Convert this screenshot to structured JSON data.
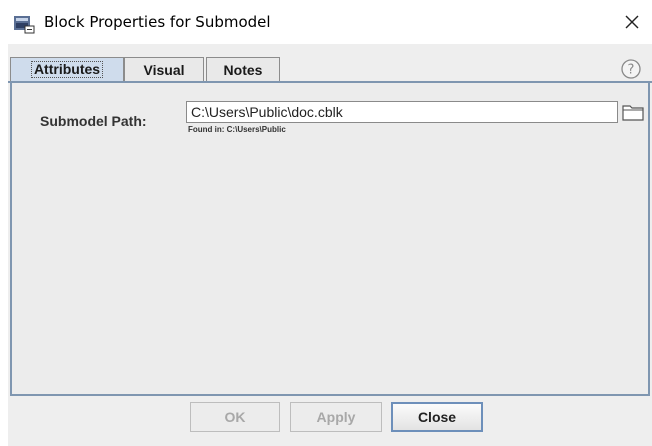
{
  "window": {
    "title": "Block Properties for Submodel",
    "icon": "block-icon",
    "close_icon": "close-icon"
  },
  "tabs": [
    {
      "label": "Attributes",
      "selected": true
    },
    {
      "label": "Visual",
      "selected": false
    },
    {
      "label": "Notes",
      "selected": false
    }
  ],
  "help_icon": "help-icon",
  "form": {
    "path_label": "Submodel Path:",
    "path_value": "C:\\Users\\Public\\doc.cblk",
    "found_in": "Found in: C:\\Users\\Public",
    "browse_icon": "folder-icon"
  },
  "buttons": {
    "ok_label": "OK",
    "ok_enabled": false,
    "apply_label": "Apply",
    "apply_enabled": false,
    "close_label": "Close"
  },
  "colors": {
    "selected_tab": "#cfdcec",
    "panel_border": "#7f96b0",
    "dialog_background": "#eeeeee"
  }
}
